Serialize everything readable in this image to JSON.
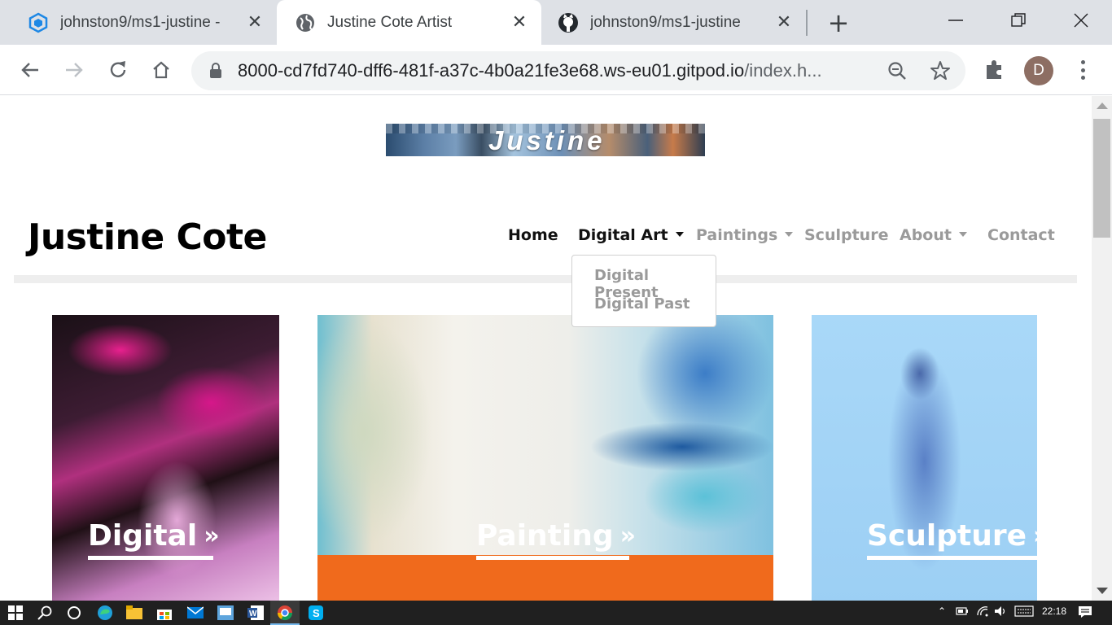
{
  "browser": {
    "tabs": [
      {
        "title": "johnston9/ms1-justine -",
        "icon": "gitpod-icon",
        "active": false
      },
      {
        "title": "Justine Cote Artist",
        "icon": "globe-icon",
        "active": true
      },
      {
        "title": "johnston9/ms1-justine",
        "icon": "github-icon",
        "active": false
      }
    ],
    "new_tab": "+",
    "url_host": "8000-cd7fd740-dff6-481f-a37c-4b0a21fe3e68.ws-eu01.gitpod.io",
    "url_path": "/index.h...",
    "profile_initial": "D"
  },
  "site": {
    "banner_text": "Justine",
    "brand": "Justine Cote",
    "nav": [
      {
        "label": "Home"
      },
      {
        "label": "Digital Art"
      },
      {
        "label": "Paintings"
      },
      {
        "label": "Sculpture"
      },
      {
        "label": "About"
      },
      {
        "label": "Contact"
      }
    ],
    "dropdown": [
      "Digital Present",
      "Digital Past"
    ],
    "cards": [
      {
        "label": "Digital"
      },
      {
        "label": "Painting"
      },
      {
        "label": "Sculpture"
      }
    ],
    "chevron": "»"
  },
  "taskbar": {
    "time": "22:18"
  }
}
